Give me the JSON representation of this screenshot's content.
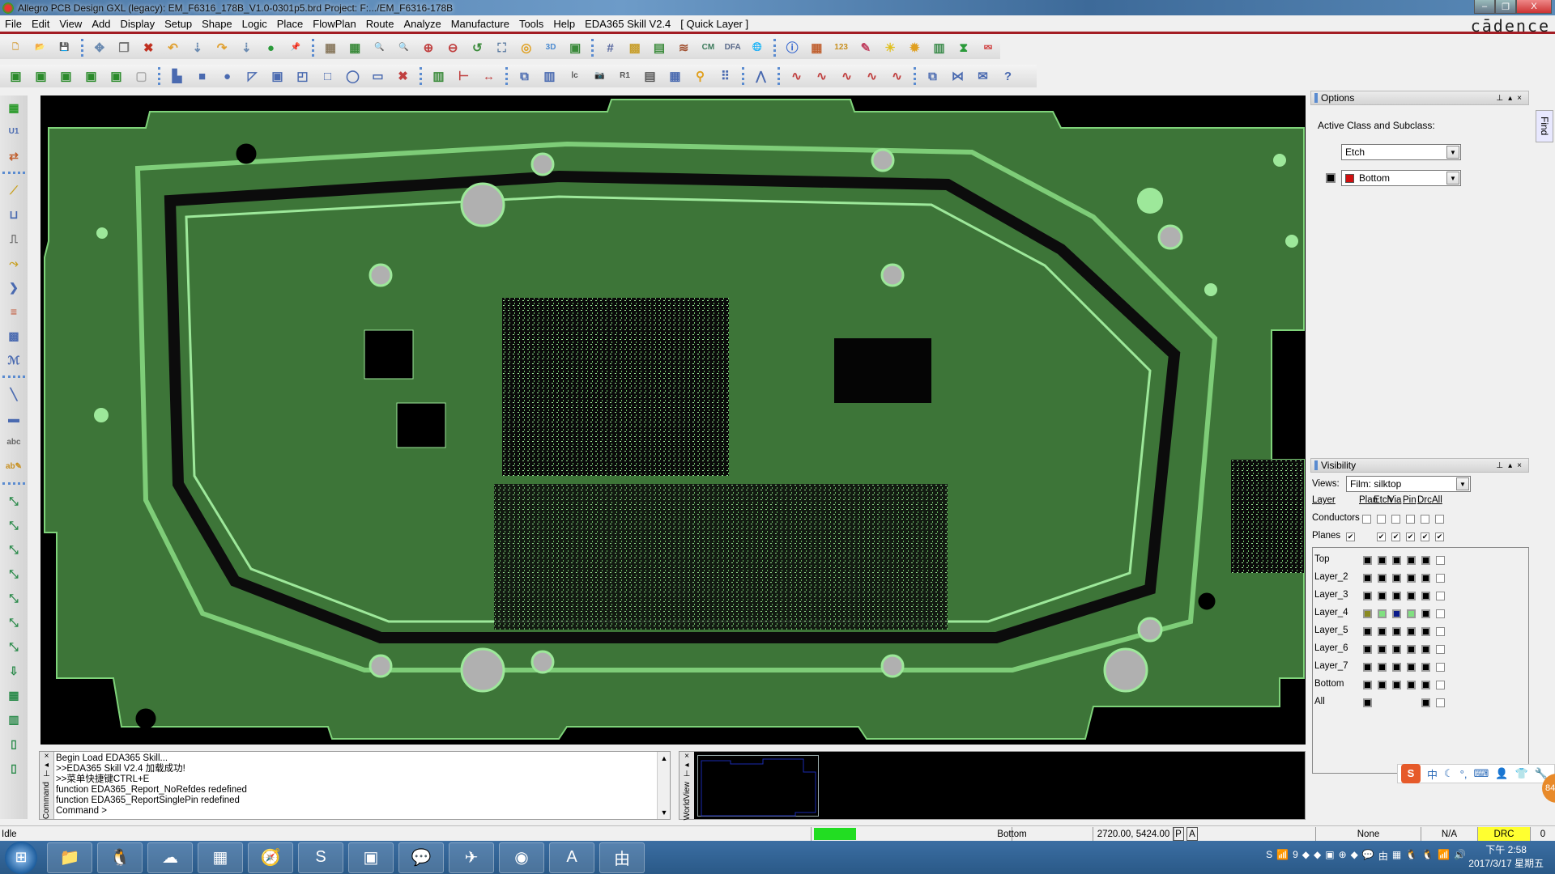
{
  "window": {
    "title": "Allegro PCB Design GXL (legacy): EM_F6316_178B_V1.0-0301p5.brd  Project: F:.../EM_F6316-178B",
    "brand": "cādence",
    "controls": {
      "minimize": "–",
      "restore": "❐",
      "close": "X"
    }
  },
  "menu": [
    "File",
    "Edit",
    "View",
    "Add",
    "Display",
    "Setup",
    "Shape",
    "Logic",
    "Place",
    "FlowPlan",
    "Route",
    "Analyze",
    "Manufacture",
    "Tools",
    "Help",
    "EDA365 Skill V2.4",
    "[ Quick Layer ]"
  ],
  "toolbar1": [
    {
      "name": "new-icon",
      "glyph": "🗋",
      "color": "#d4a040"
    },
    {
      "name": "open-icon",
      "glyph": "📂",
      "color": "#d4a040"
    },
    {
      "name": "save-icon",
      "glyph": "💾",
      "color": "#4a6aa0"
    },
    "sep",
    {
      "name": "move-icon",
      "glyph": "✥",
      "color": "#6a8ab0"
    },
    {
      "name": "copy-icon",
      "glyph": "❐",
      "color": "#777"
    },
    {
      "name": "delete-icon",
      "glyph": "✖",
      "color": "#c03020"
    },
    {
      "name": "undo-icon",
      "glyph": "↶",
      "color": "#e0a030"
    },
    {
      "name": "undo-down-icon",
      "glyph": "⇣",
      "color": "#6a8ab0"
    },
    {
      "name": "redo-icon",
      "glyph": "↷",
      "color": "#e0a030"
    },
    {
      "name": "redo-down-icon",
      "glyph": "⇣",
      "color": "#6a8ab0"
    },
    {
      "name": "ratsnest-icon",
      "glyph": "●",
      "color": "#2a9a3a"
    },
    {
      "name": "pin-icon",
      "glyph": "📌",
      "color": "#2a9a3a"
    },
    "sep",
    {
      "name": "unrats-all-icon",
      "glyph": "▦",
      "color": "#8a7a60"
    },
    {
      "name": "rats-all-icon",
      "glyph": "▦",
      "color": "#3a8a3a"
    },
    {
      "name": "zoom-points-icon",
      "glyph": "🔍",
      "color": "#666"
    },
    {
      "name": "zoom-fit-icon",
      "glyph": "🔍",
      "color": "#c04040"
    },
    {
      "name": "zoom-in-icon",
      "glyph": "⊕",
      "color": "#c04040"
    },
    {
      "name": "zoom-out-icon",
      "glyph": "⊖",
      "color": "#c04040"
    },
    {
      "name": "zoom-prev-icon",
      "glyph": "↺",
      "color": "#3a8a3a"
    },
    {
      "name": "zoom-world-icon",
      "glyph": "⛶",
      "color": "#5a7aa0"
    },
    {
      "name": "redraw-icon",
      "glyph": "◎",
      "color": "#e0a020"
    },
    {
      "name": "3d-view-icon",
      "glyph": "3D",
      "color": "#4a8ad0"
    },
    {
      "name": "flip-icon",
      "glyph": "▣",
      "color": "#3a8a3a"
    },
    "sep",
    {
      "name": "grid-icon",
      "glyph": "#",
      "color": "#5a6aa0"
    },
    {
      "name": "color-icon",
      "glyph": "▩",
      "color": "#c8a030"
    },
    {
      "name": "layer-priority-icon",
      "glyph": "▤",
      "color": "#3a8a3a"
    },
    {
      "name": "stackup-icon",
      "glyph": "≋",
      "color": "#a05030"
    },
    {
      "name": "constraint-manager-icon",
      "glyph": "CM",
      "color": "#3a7a5a"
    },
    {
      "name": "dfa-icon",
      "glyph": "DFA",
      "color": "#5a6a8a"
    },
    {
      "name": "web-icon",
      "glyph": "🌐",
      "color": "#3a7a5a"
    },
    "sep",
    {
      "name": "show-element-icon",
      "glyph": "ⓘ",
      "color": "#3a6ad0"
    },
    {
      "name": "show-info-icon",
      "glyph": "▦",
      "color": "#c06030"
    },
    {
      "name": "measure-icon",
      "glyph": "123",
      "color": "#c89020"
    },
    {
      "name": "highlight-icon",
      "glyph": "✎",
      "color": "#c04060"
    },
    {
      "name": "assign-color-icon",
      "glyph": "☀",
      "color": "#e0c020"
    },
    {
      "name": "dehighlight-icon",
      "glyph": "✹",
      "color": "#e0a020"
    },
    {
      "name": "bars-icon",
      "glyph": "▥",
      "color": "#3a8a4a"
    },
    {
      "name": "hourglass-icon",
      "glyph": "⧗",
      "color": "#2a9a3a"
    },
    {
      "name": "select-icon",
      "glyph": "⮹",
      "color": "#d04040"
    }
  ],
  "toolbar2": [
    {
      "name": "etch-layer1-icon",
      "glyph": "▣",
      "color": "#2a8a2a"
    },
    {
      "name": "etch-layer2-icon",
      "glyph": "▣",
      "color": "#2a8a2a"
    },
    {
      "name": "etch-layer3-icon",
      "glyph": "▣",
      "color": "#2a8a2a"
    },
    {
      "name": "etch-layer4-icon",
      "glyph": "▣",
      "color": "#2a8a2a"
    },
    {
      "name": "etch-layer5-icon",
      "glyph": "▣",
      "color": "#2a8a2a"
    },
    {
      "name": "etch-disabled-icon",
      "glyph": "▢",
      "color": "#aaa"
    },
    "sep",
    {
      "name": "add-rect-icon",
      "glyph": "▙",
      "color": "#4a6ab0"
    },
    {
      "name": "shape-rect-icon",
      "glyph": "■",
      "color": "#4a6ab0"
    },
    {
      "name": "shape-circle-icon",
      "glyph": "●",
      "color": "#4a6ab0"
    },
    {
      "name": "select-shape-icon",
      "glyph": "◸",
      "color": "#4a6ab0"
    },
    {
      "name": "manual-void-icon",
      "glyph": "▣",
      "color": "#4a6ab0"
    },
    {
      "name": "edit-boundary-icon",
      "glyph": "◰",
      "color": "#4a6ab0"
    },
    {
      "name": "shape-outline-icon",
      "glyph": "□",
      "color": "#4a6ab0"
    },
    {
      "name": "shape-octagon-icon",
      "glyph": "◯",
      "color": "#4a6ab0"
    },
    {
      "name": "merge-shapes-icon",
      "glyph": "▭",
      "color": "#4a6ab0"
    },
    {
      "name": "delete-island-icon",
      "glyph": "✖",
      "color": "#c04040"
    },
    "sep",
    {
      "name": "component-icon",
      "glyph": "▥",
      "color": "#3a8a3a"
    },
    {
      "name": "dimension-icon",
      "glyph": "⊢",
      "color": "#c04040"
    },
    {
      "name": "dimension-linear-icon",
      "glyph": "↔",
      "color": "#c04040"
    },
    "sep",
    {
      "name": "place-replicate-icon",
      "glyph": "⧉",
      "color": "#4a6ab0"
    },
    {
      "name": "swap-icon",
      "glyph": "▥",
      "color": "#4a6ab0"
    },
    {
      "name": "rename-icon",
      "glyph": "ⅼc",
      "color": "#555"
    },
    {
      "name": "camera-icon",
      "glyph": "📷",
      "color": "#555"
    },
    {
      "name": "refdes-icon",
      "glyph": "R1",
      "color": "#555"
    },
    {
      "name": "list-icon",
      "glyph": "▤",
      "color": "#555"
    },
    {
      "name": "matrix-icon",
      "glyph": "▦",
      "color": "#4a6ab0"
    },
    {
      "name": "tune-icon",
      "glyph": "⚲",
      "color": "#e0a020"
    },
    {
      "name": "array-icon",
      "glyph": "⠿",
      "color": "#4a6ab0"
    },
    "sep",
    {
      "name": "route-diff-icon",
      "glyph": "⋀",
      "color": "#4a6ab0"
    },
    "sep",
    {
      "name": "fanout-icon",
      "glyph": "∿",
      "color": "#c04040"
    },
    {
      "name": "spread-icon",
      "glyph": "∿",
      "color": "#c04040"
    },
    {
      "name": "gloss-icon",
      "glyph": "∿",
      "color": "#c04040"
    },
    {
      "name": "timing-icon",
      "glyph": "∿",
      "color": "#c04040"
    },
    {
      "name": "cleanup-icon",
      "glyph": "∿",
      "color": "#c04040"
    },
    "sep",
    {
      "name": "windows-icon",
      "glyph": "⧉",
      "color": "#4a6ab0"
    },
    {
      "name": "bowtie-icon",
      "glyph": "⋈",
      "color": "#4a6ab0"
    },
    {
      "name": "mail-icon",
      "glyph": "✉",
      "color": "#4a6ab0"
    },
    {
      "name": "help-icon",
      "glyph": "?",
      "color": "#4a6ab0"
    }
  ],
  "lefttoolbar": [
    {
      "name": "place-manual-icon",
      "glyph": "▦",
      "color": "#2a9a2a"
    },
    {
      "name": "place-refdes-icon",
      "glyph": "U1",
      "color": "#4a6ab0"
    },
    {
      "name": "place-swap-icon",
      "glyph": "⇄",
      "color": "#c06030"
    },
    "sep",
    {
      "name": "connect-icon",
      "glyph": "⟋",
      "color": "#c8a020"
    },
    {
      "name": "slide-icon",
      "glyph": "⊔",
      "color": "#4a6ab0"
    },
    {
      "name": "delay-tune-icon",
      "glyph": "⎍",
      "color": "#555"
    },
    {
      "name": "custom-smooth-icon",
      "glyph": "⤳",
      "color": "#c8a020"
    },
    {
      "name": "vertex-icon",
      "glyph": "❯",
      "color": "#4a6ab0"
    },
    {
      "name": "bus-icon",
      "glyph": "≡",
      "color": "#c05030"
    },
    {
      "name": "fanout-icon",
      "glyph": "▩",
      "color": "#4a6ab0"
    },
    {
      "name": "serpentine-icon",
      "glyph": "ℳ",
      "color": "#4a6ab0"
    },
    "sep",
    {
      "name": "line-icon",
      "glyph": "╲",
      "color": "#4a6ab0"
    },
    {
      "name": "rect-icon",
      "glyph": "▬",
      "color": "#4a6ab0"
    },
    {
      "name": "add-text-icon",
      "glyph": "abc",
      "color": "#666"
    },
    {
      "name": "edit-text-icon",
      "glyph": "ab✎",
      "color": "#c89020"
    },
    "sep",
    {
      "name": "net-hat-icon",
      "glyph": "⤡",
      "color": "#2a8a4a"
    },
    {
      "name": "net-icon",
      "glyph": "⤡",
      "color": "#2a8a4a"
    },
    {
      "name": "net-delete-icon",
      "glyph": "⤡",
      "color": "#2a8a4a"
    },
    {
      "name": "net-edit-icon",
      "glyph": "⤡",
      "color": "#2a8a4a"
    },
    {
      "name": "net-refresh-icon",
      "glyph": "⤡",
      "color": "#2a8a4a"
    },
    {
      "name": "net-document-icon",
      "glyph": "⤡",
      "color": "#2a8a4a"
    },
    {
      "name": "net-plain-icon",
      "glyph": "⤡",
      "color": "#2a8a4a"
    },
    {
      "name": "net-download-icon",
      "glyph": "⇩",
      "color": "#2a8a4a"
    },
    {
      "name": "net-table-icon",
      "glyph": "▦",
      "color": "#2a8a4a"
    },
    {
      "name": "net-signal-icon",
      "glyph": "▥",
      "color": "#2a8a4a"
    },
    {
      "name": "net-device-icon",
      "glyph": "▯",
      "color": "#2a8a4a"
    },
    {
      "name": "net-device2-icon",
      "glyph": "▯",
      "color": "#2a8a4a"
    }
  ],
  "options_panel": {
    "title": "Options",
    "label": "Active Class and Subclass:",
    "class_value": "Etch",
    "subclass_value": "Bottom",
    "subclass_color": "#d01010",
    "find_tab": "Find"
  },
  "visibility_panel": {
    "title": "Visibility",
    "views_label": "Views:",
    "views_value": "Film: silktop",
    "layer_label": "Layer",
    "columns": [
      "Plan",
      "Etch",
      "Via",
      "Pin",
      "Drc",
      "All"
    ],
    "conductors_label": "Conductors",
    "planes_label": "Planes",
    "conductors": [
      false,
      false,
      false,
      false,
      false,
      false
    ],
    "planes": [
      true,
      null,
      true,
      true,
      true,
      true,
      true
    ],
    "layers": [
      {
        "name": "Top",
        "colors": [
          "#000",
          "#000",
          "#000",
          "#000",
          "#000"
        ],
        "all": false
      },
      {
        "name": "Layer_2",
        "colors": [
          "#000",
          "#000",
          "#000",
          "#000",
          "#000"
        ],
        "all": false
      },
      {
        "name": "Layer_3",
        "colors": [
          "#000",
          "#000",
          "#000",
          "#000",
          "#000"
        ],
        "all": false
      },
      {
        "name": "Layer_4",
        "colors": [
          "#8a8a20",
          "#80e080",
          "#0a1a8a",
          "#80e080",
          "#000"
        ],
        "all": false
      },
      {
        "name": "Layer_5",
        "colors": [
          "#000",
          "#000",
          "#000",
          "#000",
          "#000"
        ],
        "all": false
      },
      {
        "name": "Layer_6",
        "colors": [
          "#000",
          "#000",
          "#000",
          "#000",
          "#000"
        ],
        "all": false
      },
      {
        "name": "Layer_7",
        "colors": [
          "#000",
          "#000",
          "#000",
          "#000",
          "#000"
        ],
        "all": false
      },
      {
        "name": "Bottom",
        "colors": [
          "#000",
          "#000",
          "#000",
          "#000",
          "#000"
        ],
        "all": false
      },
      {
        "name": "All",
        "colors": [
          "#000",
          null,
          null,
          null,
          "#000"
        ],
        "all": false
      }
    ]
  },
  "command_window": {
    "tab_label": "Command",
    "lines": [
      "Begin Load EDA365 Skill...",
      ">>EDA365 Skill V2.4 加载成功!",
      ">>菜单快捷键CTRL+E",
      "function EDA365_Report_NoRefdes redefined",
      "function EDA365_ReportSinglePin redefined",
      "Command >"
    ]
  },
  "worldview": {
    "tab_label": "WorldView"
  },
  "statusbar": {
    "state": "Idle",
    "indicator_color": "#22dd22",
    "layer": "Bottom",
    "coords": "2720.00, 5424.00",
    "p_btn": "P",
    "a_btn": "A",
    "none": "None",
    "na": "N/A",
    "drc": "DRC",
    "drc_color": "#ffff30",
    "drc_count": "0"
  },
  "ime_bar": {
    "logo": "S",
    "items": [
      "中",
      "☾",
      "°,",
      "⌨",
      "👤",
      "👕",
      "🔧"
    ],
    "badge": "84"
  },
  "taskbar": {
    "start": "⊞",
    "apps": [
      {
        "name": "explorer-icon",
        "glyph": "📁"
      },
      {
        "name": "qq-icon",
        "glyph": "🐧"
      },
      {
        "name": "baidu-cloud-icon",
        "glyph": "☁"
      },
      {
        "name": "calculator-icon",
        "glyph": "▦"
      },
      {
        "name": "browser-icon",
        "glyph": "🧭"
      },
      {
        "name": "wps-icon",
        "glyph": "S"
      },
      {
        "name": "allegro-design-icon",
        "glyph": "▣"
      },
      {
        "name": "wechat-icon",
        "glyph": "💬"
      },
      {
        "name": "allegro-pcb-icon",
        "glyph": "✈"
      },
      {
        "name": "media-icon",
        "glyph": "◉"
      },
      {
        "name": "text-editor-icon",
        "glyph": "A"
      },
      {
        "name": "pdf-icon",
        "glyph": "由"
      }
    ],
    "tray": [
      "S",
      "📶",
      "9",
      "◆",
      "◆",
      "▣",
      "⊕",
      "◆",
      "💬",
      "由",
      "▦",
      "🐧",
      "🐧",
      "📶",
      "🔊"
    ],
    "time": "下午 2:58",
    "date": "2017/3/17 星期五"
  }
}
